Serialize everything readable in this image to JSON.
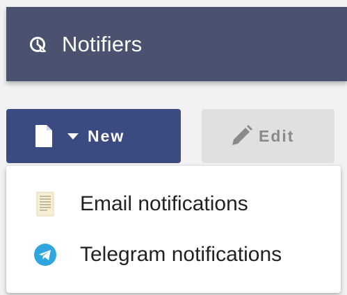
{
  "header": {
    "title": "Notifiers",
    "icon": "notifier-icon"
  },
  "toolbar": {
    "new_label": "New",
    "edit_label": "Edit",
    "new_icon": "document-icon",
    "edit_icon": "pencil-icon"
  },
  "menu": {
    "items": [
      {
        "label": "Email notifications",
        "icon": "email-document-icon"
      },
      {
        "label": "Telegram notifications",
        "icon": "telegram-icon"
      }
    ]
  },
  "colors": {
    "header_bg": "#4a5270",
    "new_button_bg": "#3c4a82",
    "edit_button_bg": "#e0e0e0",
    "telegram_blue": "#2ea6e0"
  }
}
